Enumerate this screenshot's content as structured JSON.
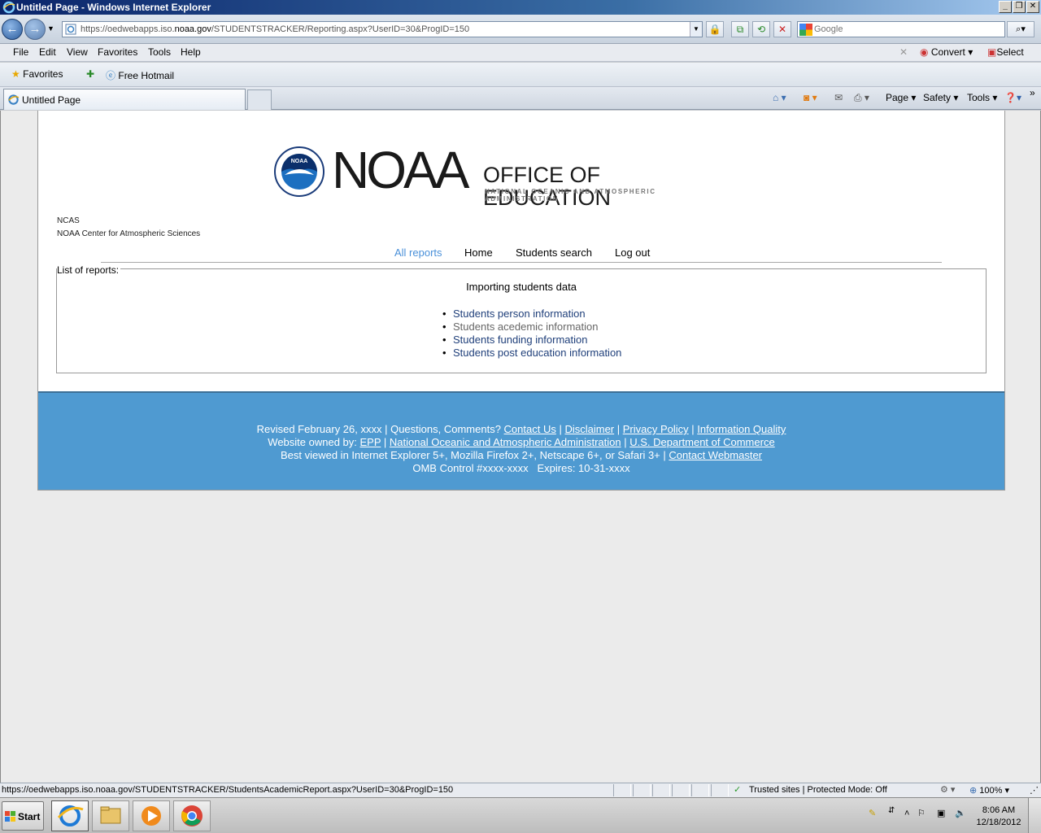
{
  "window": {
    "title": "Untitled Page - Windows Internet Explorer"
  },
  "address": {
    "url_prefix": "https://oedwebapps.iso.",
    "url_domain": "noaa.gov",
    "url_suffix": "/STUDENTSTRACKER/Reporting.aspx?UserID=30&ProgID=150"
  },
  "search": {
    "placeholder": "Google"
  },
  "menu": {
    "items": [
      "File",
      "Edit",
      "View",
      "Favorites",
      "Tools",
      "Help"
    ],
    "convert": "Convert",
    "select": "Select"
  },
  "favorites": {
    "favorites_label": "Favorites",
    "free_hotmail": "Free Hotmail"
  },
  "tab": {
    "title": "Untitled Page"
  },
  "commandbar": {
    "page": "Page",
    "safety": "Safety",
    "tools": "Tools"
  },
  "page": {
    "logo": {
      "noaa": "NOAA",
      "office": "OFFICE OF EDUCATION",
      "subtitle": "NATIONAL OCEANIC AND ATMOSPHERIC ADMINISTRATION"
    },
    "org_short": "NCAS",
    "org_full": "NOAA Center for Atmospheric Sciences",
    "nav": {
      "all_reports": "All reports",
      "home": "Home",
      "students_search": "Students search",
      "log_out": "Log out"
    },
    "reports": {
      "legend": "List of reports:",
      "heading": "Importing students data",
      "items": [
        "Students person information",
        "Students acedemic information",
        "Students funding information",
        "Students post education information"
      ]
    },
    "footer": {
      "revised": "Revised February 26, xxxx | Questions, Comments? ",
      "contact_us": "Contact Us",
      "sep1": " | ",
      "disclaimer": "Disclaimer",
      "privacy": "Privacy Policy",
      "info_quality": "Information Quality",
      "owned_by": "Website owned by: ",
      "epp": "EPP",
      "noaa_full": "National Oceanic and Atmospheric Administration",
      "doc": "U.S. Department of Commerce",
      "best_viewed": "Best viewed in Internet Explorer 5+, Mozilla Firefox 2+, Netscape 6+, or Safari 3+ | ",
      "webmaster": "Contact Webmaster",
      "omb": "OMB Control #xxxx-xxxx   Expires: 10-31-xxxx"
    }
  },
  "status": {
    "url": "https://oedwebapps.iso.noaa.gov/STUDENTSTRACKER/StudentsAcademicReport.aspx?UserID=30&ProgID=150",
    "zone": "Trusted sites | Protected Mode: Off",
    "zoom": "100%"
  },
  "taskbar": {
    "start": "Start",
    "time": "8:06 AM",
    "date": "12/18/2012"
  },
  "colors": {
    "link": "#1f3f7a",
    "link_visited": "#666666",
    "nav_active": "#4a90d9",
    "footer_bg": "#4f9ad1"
  }
}
